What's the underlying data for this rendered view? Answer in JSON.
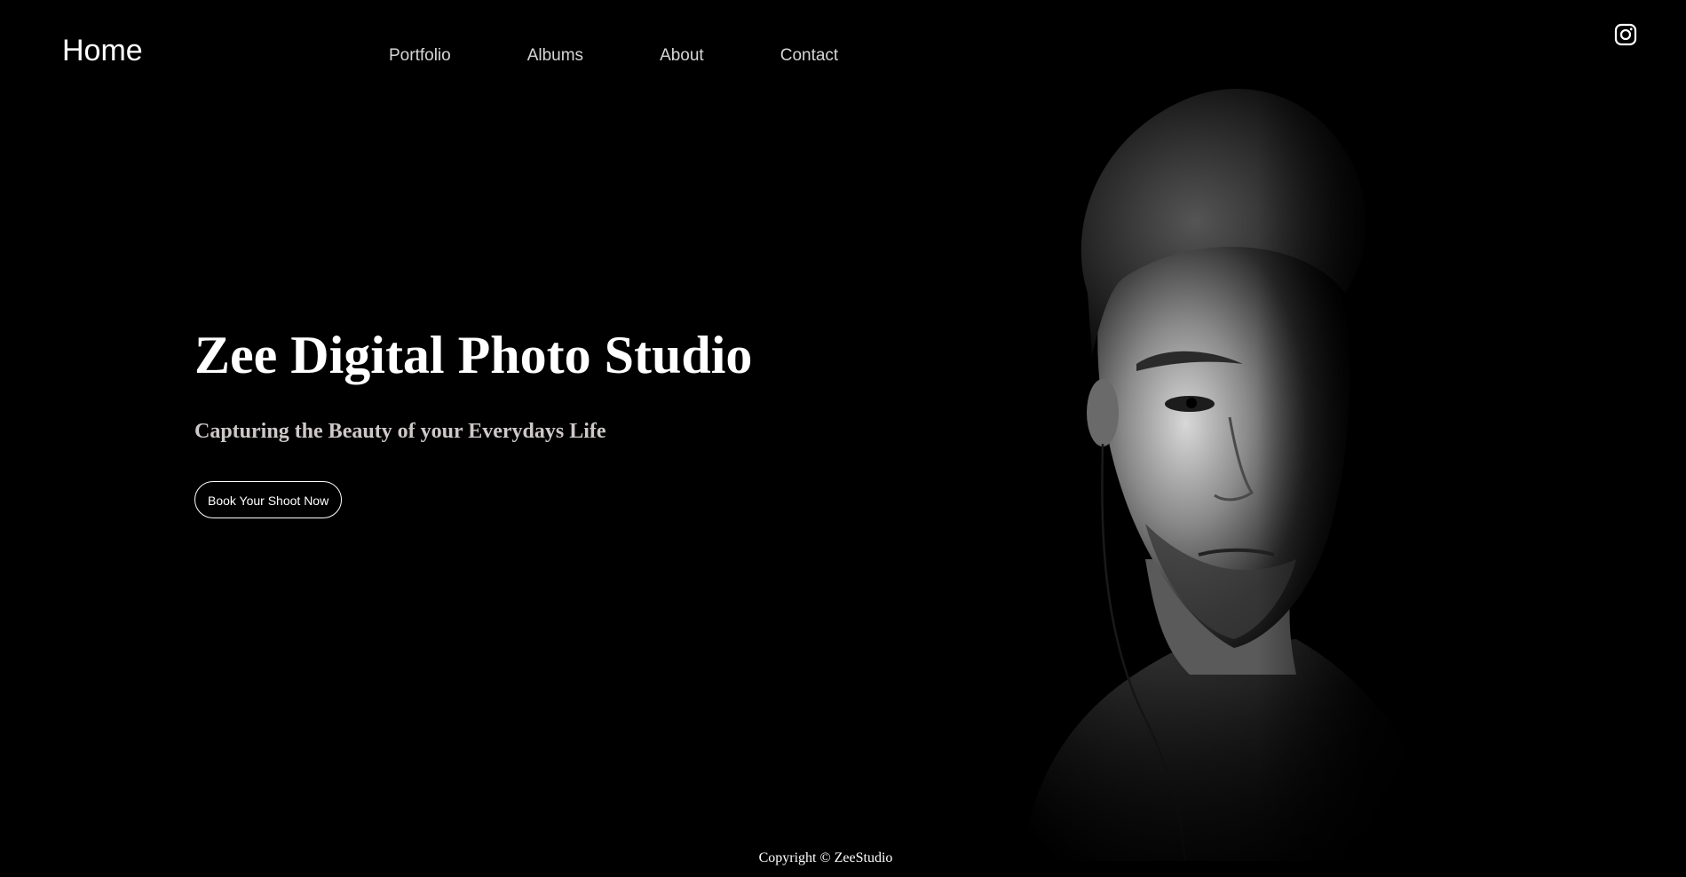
{
  "nav": {
    "brand": "Home",
    "links": [
      "Portfolio",
      "Albums",
      "About",
      "Contact"
    ],
    "social_icon": "instagram-icon"
  },
  "hero": {
    "title": "Zee Digital Photo Studio",
    "subtitle": "Capturing the Beauty of your Everydays Life",
    "cta_label": "Book Your Shoot Now",
    "image": "black-and-white-portrait-of-man"
  },
  "footer": {
    "copyright": "Copyright © ZeeStudio"
  },
  "colors": {
    "background": "#000000",
    "text": "#ffffff",
    "nav_text": "#d6d6d6",
    "subtitle": "#cfc8c8"
  }
}
